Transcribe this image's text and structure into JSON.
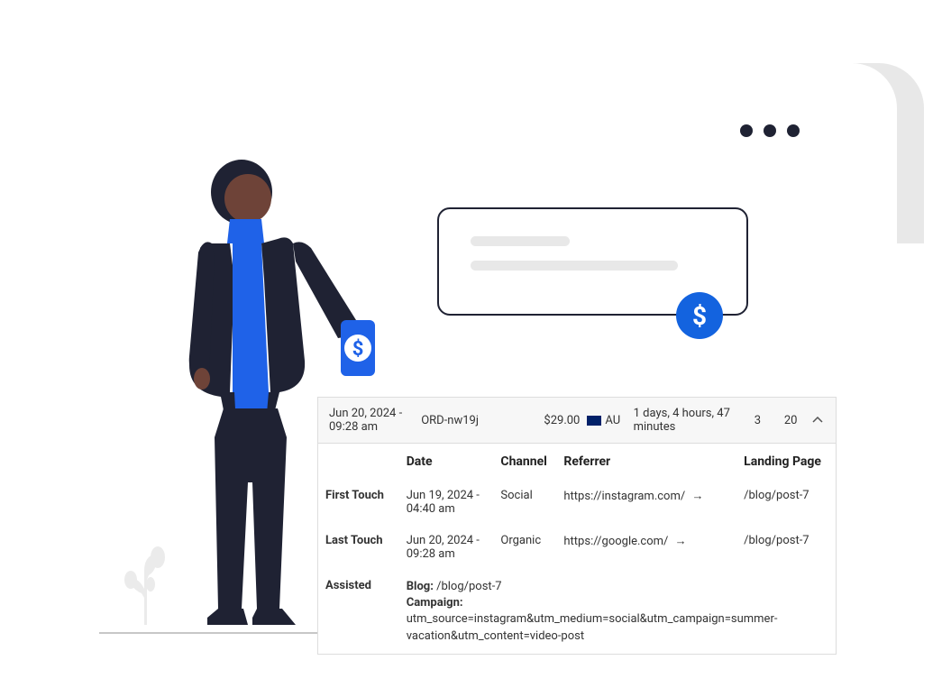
{
  "summary": {
    "date": "Jun 20, 2024 - 09:28 am",
    "order_id": "ORD-nw19j",
    "price": "$29.00",
    "country_code": "AU",
    "duration": "1 days, 4 hours, 47 minutes",
    "num1": "3",
    "num2": "20"
  },
  "headers": {
    "date": "Date",
    "channel": "Channel",
    "referrer": "Referrer",
    "landing": "Landing Page"
  },
  "rows": {
    "first_touch": {
      "label": "First Touch",
      "date": "Jun 19, 2024 - 04:40 am",
      "channel": "Social",
      "referrer": "https://instagram.com/",
      "arrow": "→",
      "landing": "/blog/post-7"
    },
    "last_touch": {
      "label": "Last Touch",
      "date": "Jun 20, 2024 - 09:28 am",
      "channel": "Organic",
      "referrer": "https://google.com/",
      "arrow": "→",
      "landing": "/blog/post-7"
    },
    "assisted": {
      "label": "Assisted",
      "blog_label": "Blog: ",
      "blog_value": "/blog/post-7",
      "campaign_label": "Campaign: ",
      "campaign_value": "utm_source=instagram&utm_medium=social&utm_campaign=summer-vacation&utm_content=video-post"
    }
  },
  "icons": {
    "dollar": "$",
    "chevron_up": "⌃"
  }
}
